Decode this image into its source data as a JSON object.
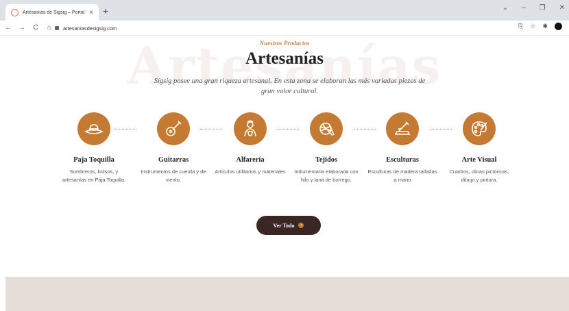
{
  "browser": {
    "tab_title": "Artesanías de Sigsig – Portal Vir",
    "url": "artesaniasdesigsig.com",
    "tab_close": "×",
    "new_tab": "+",
    "window_controls": [
      "⌄",
      "–",
      "❐",
      "✕"
    ],
    "nav": [
      "←",
      "→",
      "C",
      "⌂"
    ]
  },
  "page": {
    "watermark": "Artesanías",
    "subtitle": "Nuestros Productos",
    "title": "Artesanías",
    "intro": "Sígsig posee una gran riqueza artesanal. En esta zona se elaboran las más variadas piezas de gran valor cultural.",
    "items": [
      {
        "title": "Paja Toquilla",
        "desc": "Sombreros, bolsos, y artesanías en Paja Toquilla.",
        "icon": "hat-icon"
      },
      {
        "title": "Guitarras",
        "desc": "Instrumentos de cuerda y de viento.",
        "icon": "guitar-icon"
      },
      {
        "title": "Alfarería",
        "desc": "Artículos utilitarios y materiales",
        "icon": "potter-icon"
      },
      {
        "title": "Tejidos",
        "desc": "Indumentaria elaborada con hilo y lana de borrego.",
        "icon": "yarn-icon"
      },
      {
        "title": "Esculturas",
        "desc": "Esculturas de madera talladas a mano",
        "icon": "sculpture-icon"
      },
      {
        "title": "Arte Visual",
        "desc": "Cuadros, obras pictóricas, dibujo y pintura.",
        "icon": "palette-icon"
      }
    ],
    "cta_label": "Ver Todo",
    "colors": {
      "accent": "#c47a33",
      "button": "#3a2723",
      "band": "#e6ddd6"
    }
  }
}
